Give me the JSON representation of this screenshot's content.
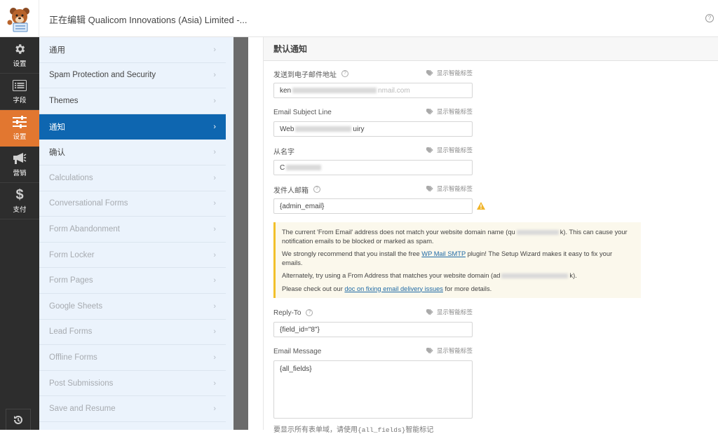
{
  "header": {
    "title": "正在编辑 Qualicom Innovations (Asia) Limited -...",
    "help_icon": "question-circle-icon"
  },
  "iconbar": {
    "items": [
      {
        "label": "设置",
        "icon": "gear-icon",
        "active": false
      },
      {
        "label": "字段",
        "icon": "list-icon",
        "active": false
      },
      {
        "label": "设置",
        "icon": "sliders-icon",
        "active": true
      },
      {
        "label": "营销",
        "icon": "megaphone-icon",
        "active": false
      },
      {
        "label": "支付",
        "icon": "dollar-icon",
        "active": false
      }
    ],
    "revisions_icon": "history-icon"
  },
  "settings_menu": {
    "items": [
      {
        "label": "通用",
        "state": "normal"
      },
      {
        "label": "Spam Protection and Security",
        "state": "normal"
      },
      {
        "label": "Themes",
        "state": "normal"
      },
      {
        "label": "通知",
        "state": "active"
      },
      {
        "label": "确认",
        "state": "normal"
      },
      {
        "label": "Calculations",
        "state": "disabled"
      },
      {
        "label": "Conversational Forms",
        "state": "disabled"
      },
      {
        "label": "Form Abandonment",
        "state": "disabled"
      },
      {
        "label": "Form Locker",
        "state": "disabled"
      },
      {
        "label": "Form Pages",
        "state": "disabled"
      },
      {
        "label": "Google Sheets",
        "state": "disabled"
      },
      {
        "label": "Lead Forms",
        "state": "disabled"
      },
      {
        "label": "Offline Forms",
        "state": "disabled"
      },
      {
        "label": "Post Submissions",
        "state": "disabled"
      },
      {
        "label": "Save and Resume",
        "state": "disabled"
      }
    ],
    "chevron": "›"
  },
  "content": {
    "panel_title": "默认通知",
    "smart_tag_label": "显示智能标签",
    "fields": {
      "send_to": {
        "label": "发送到电子邮件地址",
        "value_start": "ken",
        "value_end": "nmail.com"
      },
      "subject": {
        "label": "Email Subject Line",
        "value_start": "Web",
        "value_end": "uiry"
      },
      "from_name": {
        "label": "从名字",
        "value_start": "C",
        "value_end": ""
      },
      "from_email": {
        "label": "发件人邮箱",
        "value": "{admin_email}"
      },
      "reply_to": {
        "label": "Reply-To",
        "value": "{field_id=\"8\"}"
      },
      "message": {
        "label": "Email Message",
        "value": "{all_fields}"
      }
    },
    "notice": {
      "p1_before": "The current 'From Email' address does not match your website domain name (qu",
      "p1_after": "k). This can cause your notification emails to be blocked or marked as spam.",
      "p2_before": "We strongly recommend that you install the free ",
      "p2_link": "WP Mail SMTP",
      "p2_after": " plugin! The Setup Wizard makes it easy to fix your emails.",
      "p3_before": "Alternately, try using a From Address that matches your website domain (ad",
      "p3_after": "k).",
      "p4_before": "Please check out our ",
      "p4_link": "doc on fixing email delivery issues",
      "p4_after": " for more details.",
      "accent": "#f2c02a"
    },
    "bottom_hint_before": "要显示所有表单域，请使用",
    "bottom_hint_code": "{all_fields}",
    "bottom_hint_after": "智能标记"
  },
  "colors": {
    "active_icon": "#e27730",
    "active_menu": "#0e66b0",
    "link": "#1f6aa5",
    "warning": "#f0b429"
  }
}
